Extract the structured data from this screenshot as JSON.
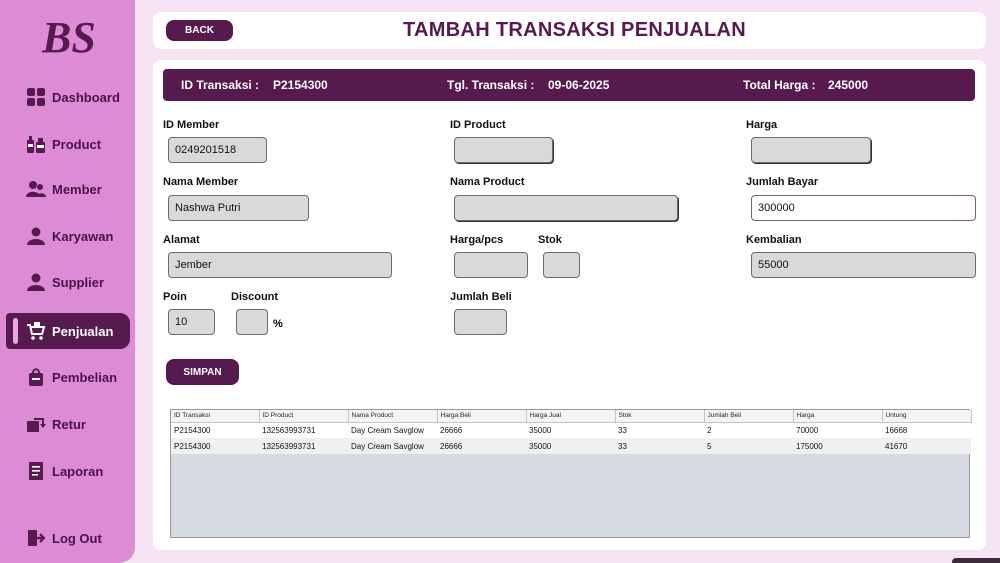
{
  "brand": {
    "logo_text": "BS"
  },
  "sidebar": {
    "items": [
      {
        "label": "Dashboard",
        "icon": "dashboard-icon"
      },
      {
        "label": "Product",
        "icon": "product-icon"
      },
      {
        "label": "Member",
        "icon": "member-icon"
      },
      {
        "label": "Karyawan",
        "icon": "karyawan-icon"
      },
      {
        "label": "Supplier",
        "icon": "supplier-icon"
      },
      {
        "label": "Penjualan",
        "icon": "cart-icon",
        "active": true
      },
      {
        "label": "Pembelian",
        "icon": "bag-icon"
      },
      {
        "label": "Retur",
        "icon": "retur-icon"
      },
      {
        "label": "Laporan",
        "icon": "report-icon"
      }
    ],
    "logout": "Log Out"
  },
  "header": {
    "back_label": "BACK",
    "title": "TAMBAH TRANSAKSI PENJUALAN"
  },
  "info": {
    "id_label": "ID Transaksi :",
    "id_value": "P2154300",
    "date_label": "Tgl. Transaksi :",
    "date_value": "09-06-2025",
    "total_label": "Total Harga :",
    "total_value": "245000"
  },
  "form": {
    "id_member_label": "ID Member",
    "id_member_value": "0249201518",
    "nama_member_label": "Nama Member",
    "nama_member_value": "Nashwa Putri",
    "alamat_label": "Alamat",
    "alamat_value": "Jember",
    "poin_label": "Poin",
    "poin_value": "10",
    "discount_label": "Discount",
    "discount_value": "",
    "percent": "%",
    "id_product_label": "ID Product",
    "id_product_value": "",
    "nama_product_label": "Nama Product",
    "nama_product_value": "",
    "harga_pcs_label": "Harga/pcs",
    "harga_pcs_value": "",
    "stok_label": "Stok",
    "stok_value": "",
    "jumlah_beli_label": "Jumlah Beli",
    "jumlah_beli_value": "",
    "harga_label": "Harga",
    "harga_value": "",
    "jumlah_bayar_label": "Jumlah Bayar",
    "jumlah_bayar_value": "300000",
    "kembalian_label": "Kembalian",
    "kembalian_value": "55000",
    "save_label": "SIMPAN"
  },
  "table": {
    "columns": [
      "ID Transaksi",
      "ID Product",
      "Nama Product",
      "Harga Beli",
      "Harga Jual",
      "Stok",
      "Jumlah Beli",
      "Harga",
      "Untung"
    ],
    "rows": [
      [
        "P2154300",
        "132563993731",
        "Day Cream Savglow",
        "26666",
        "35000",
        "33",
        "2",
        "70000",
        "16668"
      ],
      [
        "P2154300",
        "132563993731",
        "Day Cream Savglow",
        "26666",
        "35000",
        "33",
        "5",
        "175000",
        "41670"
      ]
    ]
  }
}
